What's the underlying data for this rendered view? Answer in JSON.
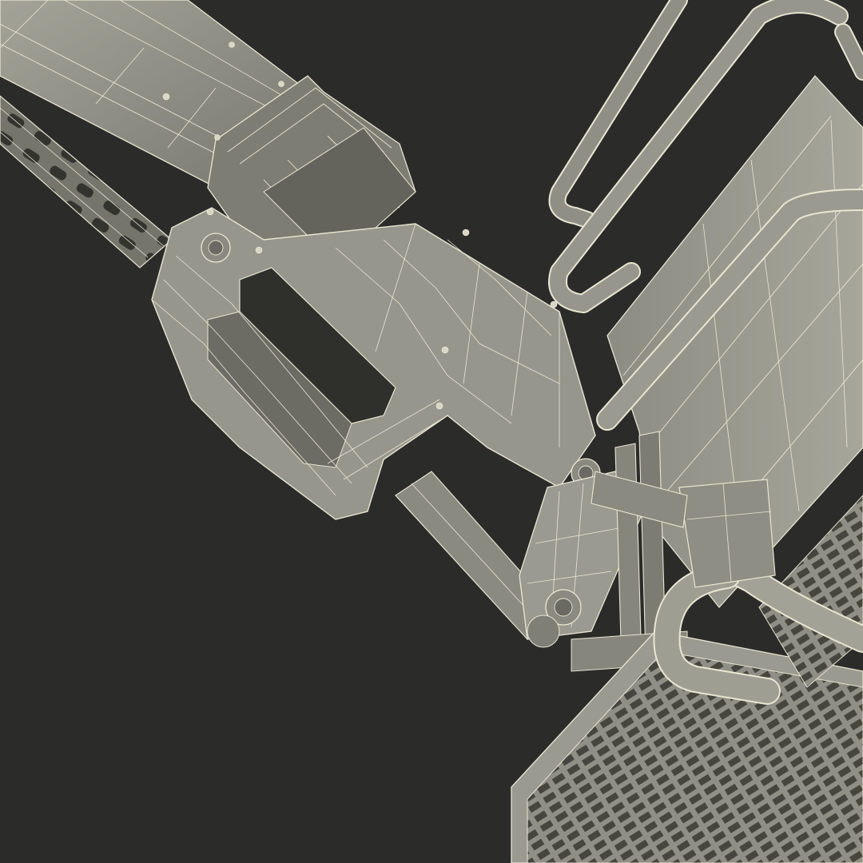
{
  "scene": {
    "subject": "wireframe-render",
    "colors": {
      "background": "#2b2b29",
      "surface_light": "#9e9e93",
      "surface_mid": "#85857b",
      "surface_dark": "#5f5f58",
      "wire": "#e8e6d2",
      "shadow": "#3c3c38"
    }
  }
}
